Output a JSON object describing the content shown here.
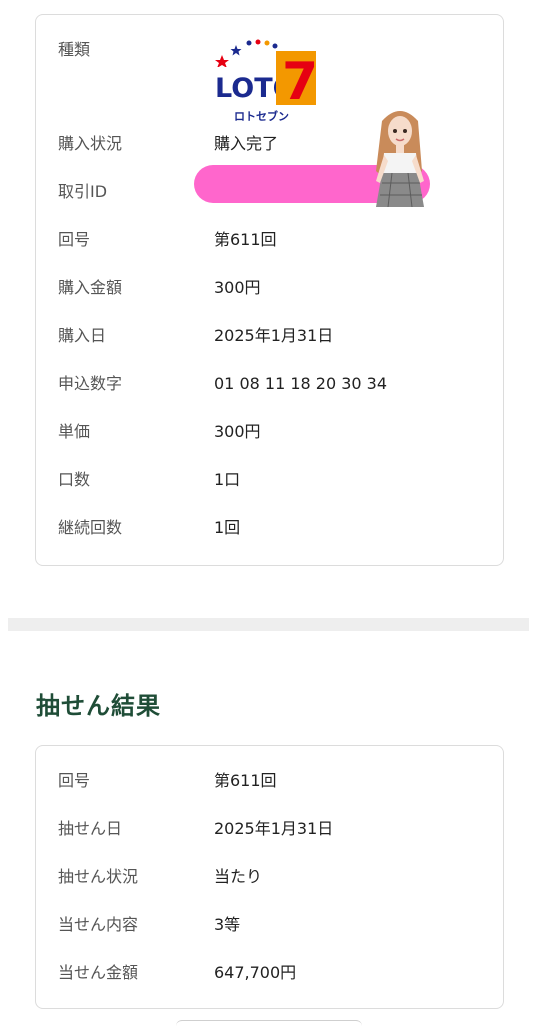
{
  "purchase": {
    "type_label": "種類",
    "logo": {
      "text_main": "LOTO",
      "text_seven": "7",
      "text_sub": "ロトセブン"
    },
    "rows": [
      {
        "label": "購入状況",
        "value": "購入完了"
      },
      {
        "label": "取引ID",
        "value": ""
      },
      {
        "label": "回号",
        "value": "第611回"
      },
      {
        "label": "購入金額",
        "value": "300円"
      },
      {
        "label": "購入日",
        "value": "2025年1月31日"
      },
      {
        "label": "申込数字",
        "value": "01 08 11 18 20 30 34"
      },
      {
        "label": "単価",
        "value": "300円"
      },
      {
        "label": "口数",
        "value": "1口"
      },
      {
        "label": "継続回数",
        "value": "1回"
      }
    ]
  },
  "result": {
    "title": "抽せん結果",
    "rows": [
      {
        "label": "回号",
        "value": "第611回"
      },
      {
        "label": "抽せん日",
        "value": "2025年1月31日"
      },
      {
        "label": "抽せん状況",
        "value": "当たり"
      },
      {
        "label": "当せん内容",
        "value": "3等"
      },
      {
        "label": "当せん金額",
        "value": "647,700円"
      }
    ]
  },
  "colors": {
    "section_title": "#1f4d37",
    "redaction": "#ff66cc",
    "logo_blue": "#1b2a8f",
    "logo_orange": "#f39800",
    "logo_red": "#e60012"
  }
}
